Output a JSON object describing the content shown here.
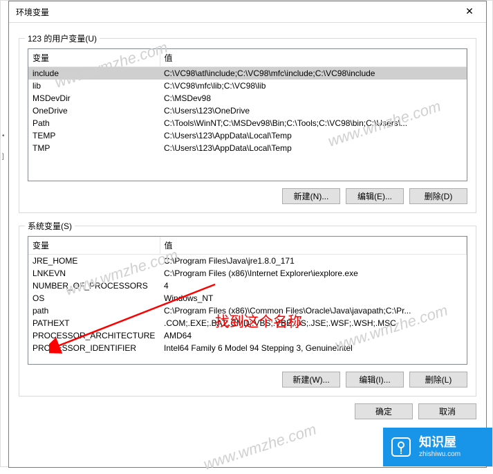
{
  "dialog": {
    "title": "环境变量",
    "close_glyph": "✕"
  },
  "user_vars": {
    "group_label": "123 的用户变量(U)",
    "col_var": "变量",
    "col_val": "值",
    "rows": [
      {
        "var": "include",
        "val": "C:\\VC98\\atl\\include;C:\\VC98\\mfc\\include;C:\\VC98\\include"
      },
      {
        "var": "lib",
        "val": "C:\\VC98\\mfc\\lib;C:\\VC98\\lib"
      },
      {
        "var": "MSDevDir",
        "val": "C:\\MSDev98"
      },
      {
        "var": "OneDrive",
        "val": "C:\\Users\\123\\OneDrive"
      },
      {
        "var": "Path",
        "val": "C:\\Tools\\WinNT;C:\\MSDev98\\Bin;C:\\Tools;C:\\VC98\\bin;C:\\Users\\..."
      },
      {
        "var": "TEMP",
        "val": "C:\\Users\\123\\AppData\\Local\\Temp"
      },
      {
        "var": "TMP",
        "val": "C:\\Users\\123\\AppData\\Local\\Temp"
      }
    ],
    "btn_new": "新建(N)...",
    "btn_edit": "编辑(E)...",
    "btn_del": "删除(D)"
  },
  "sys_vars": {
    "group_label": "系统变量(S)",
    "col_var": "变量",
    "col_val": "值",
    "rows": [
      {
        "var": "JRE_HOME",
        "val": "C:\\Program Files\\Java\\jre1.8.0_171"
      },
      {
        "var": "LNKEVN",
        "val": "C:\\Program Files (x86)\\Internet Explorer\\iexplore.exe"
      },
      {
        "var": "NUMBER_OF_PROCESSORS",
        "val": "4"
      },
      {
        "var": "OS",
        "val": "Windows_NT"
      },
      {
        "var": "path",
        "val": "C:\\Program Files (x86)\\Common Files\\Oracle\\Java\\javapath;C:\\Pr..."
      },
      {
        "var": "PATHEXT",
        "val": ".COM;.EXE;.BAT;.CMD;.VBS;.VBE;.JS;.JSE;.WSF;.WSH;.MSC"
      },
      {
        "var": "PROCESSOR_ARCHITECTURE",
        "val": "AMD64"
      },
      {
        "var": "PROCESSOR_IDENTIFIER",
        "val": "Intel64 Family 6 Model 94 Stepping 3, GenuineIntel"
      }
    ],
    "btn_new": "新建(W)...",
    "btn_edit": "编辑(I)...",
    "btn_del": "删除(L)"
  },
  "footer": {
    "ok": "确定",
    "cancel": "取消"
  },
  "annotation": {
    "text": "找到这个名称"
  },
  "watermark": {
    "text": "www.wmzhe.com"
  },
  "logo": {
    "title": "知识屋",
    "subtitle": "zhishiwu.com"
  }
}
